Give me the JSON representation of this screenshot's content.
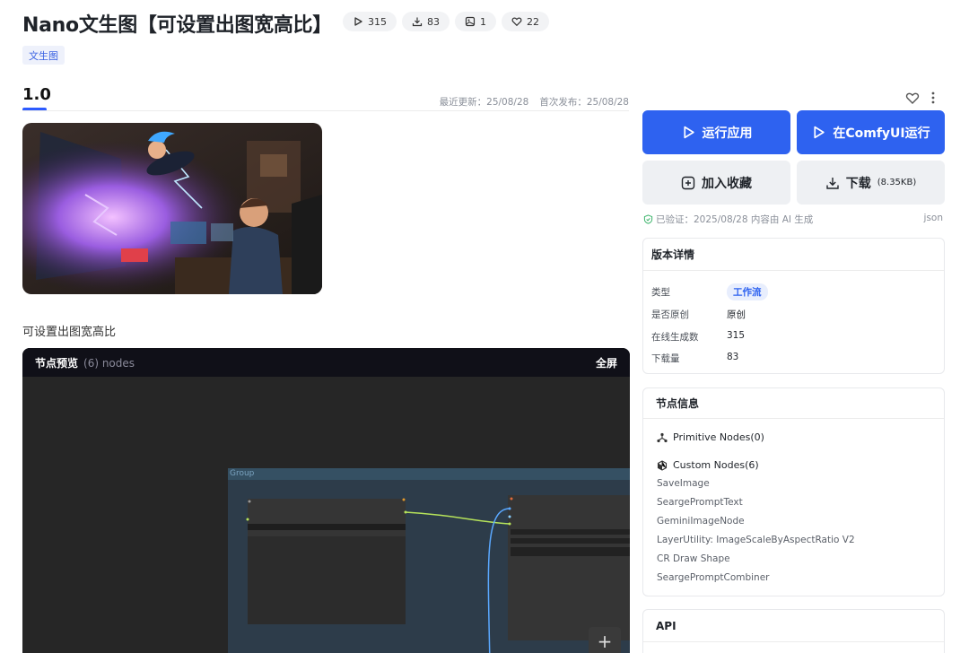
{
  "header": {
    "title": "Nano文生图【可设置出图宽高比】",
    "stats": {
      "runs": "315",
      "downloads": "83",
      "images": "1",
      "likes": "22"
    },
    "tag": "文生图"
  },
  "version": {
    "label": "1.0",
    "last_update": "最近更新：25/08/28",
    "first_publish": "首次发布：25/08/28"
  },
  "description": "可设置出图宽高比",
  "preview": {
    "title": "节点预览",
    "count": "(6) nodes",
    "fullscreen": "全屏",
    "group_label": "Group",
    "plus": "+"
  },
  "actions": {
    "run_app": "运行应用",
    "run_comfy": "在ComfyUI运行",
    "favorite": "加入收藏",
    "download": "下载",
    "download_size": "(8.35KB)",
    "verified": "已验证：2025/08/28 内容由 AI 生成",
    "json": "json"
  },
  "version_details": {
    "title": "版本详情",
    "rows": [
      {
        "key": "类型",
        "value": "工作流"
      },
      {
        "key": "是否原创",
        "value": "原创"
      },
      {
        "key": "在线生成数",
        "value": "315"
      },
      {
        "key": "下载量",
        "value": "83"
      }
    ]
  },
  "node_info": {
    "title": "节点信息",
    "primitive": "Primitive Nodes(0)",
    "custom": "Custom Nodes(6)",
    "items": [
      "SaveImage",
      "SeargePromptText",
      "GeminiImageNode",
      "LayerUtility: ImageScaleByAspectRatio V2",
      "CR Draw Shape",
      "SeargePromptCombiner"
    ]
  },
  "api": {
    "title": "API"
  },
  "colors": {
    "accent": "#2e62f0",
    "tag_bg": "#eef1fb",
    "preview_bg": "#262626",
    "group_bg": "#2d3c4a"
  }
}
